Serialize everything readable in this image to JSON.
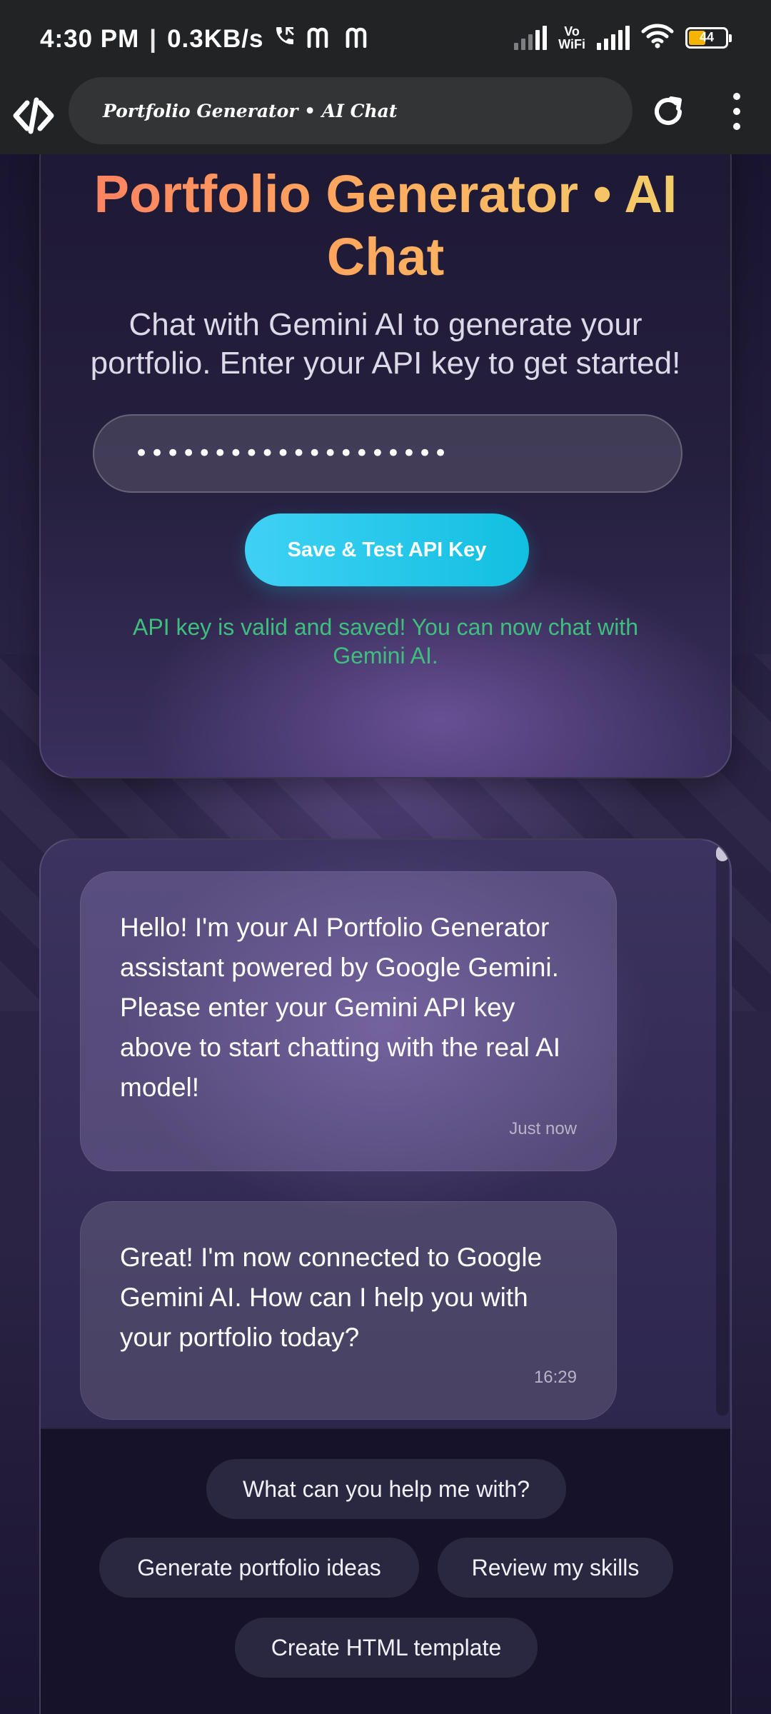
{
  "status_bar": {
    "time": "4:30 PM",
    "separator": "|",
    "network_speed": "0.3KB/s",
    "icons": [
      "call-icon",
      "mail-icon",
      "mail-icon",
      "signal-icon",
      "vowifi-icon",
      "signal-icon",
      "wifi-icon",
      "battery-icon"
    ],
    "vowifi_top": "Vo",
    "vowifi_bottom": "WiFi",
    "battery_level": "44",
    "battery_fill_fraction": 0.44,
    "battery_color": "#f4b400"
  },
  "browser": {
    "url_title": "Portfolio Generator • AI Chat",
    "site_icon": "code-logo-icon",
    "reload_icon": "reload-icon",
    "menu_icon": "more-vert-icon"
  },
  "hero": {
    "title": "Portfolio Generator • AI Chat",
    "subtitle": "Chat with Gemini AI to generate your portfolio. Enter your API key to get started!",
    "api_input_value": "••••••••••••••••••••",
    "api_button_label": "Save & Test API Key",
    "status_message": "API key is valid and saved! You can now chat with Gemini AI.",
    "title_gradient": [
      "#ff7f61",
      "#ffa85e",
      "#f2cf6b"
    ],
    "button_color": "#12bfe0",
    "status_color": "#3fbf7f"
  },
  "chat": {
    "messages": [
      {
        "text": "Hello! I'm your AI Portfolio Generator assistant powered by Google Gemini. Please enter your Gemini API key above to start chatting with the real AI model!",
        "time": "Just now"
      },
      {
        "text": "Great! I'm now connected to Google Gemini AI. How can I help you with your portfolio today?",
        "time": "16:29"
      }
    ],
    "quick_replies": [
      "What can you help me with?",
      "Generate portfolio ideas",
      "Review my skills",
      "Create HTML template"
    ]
  }
}
